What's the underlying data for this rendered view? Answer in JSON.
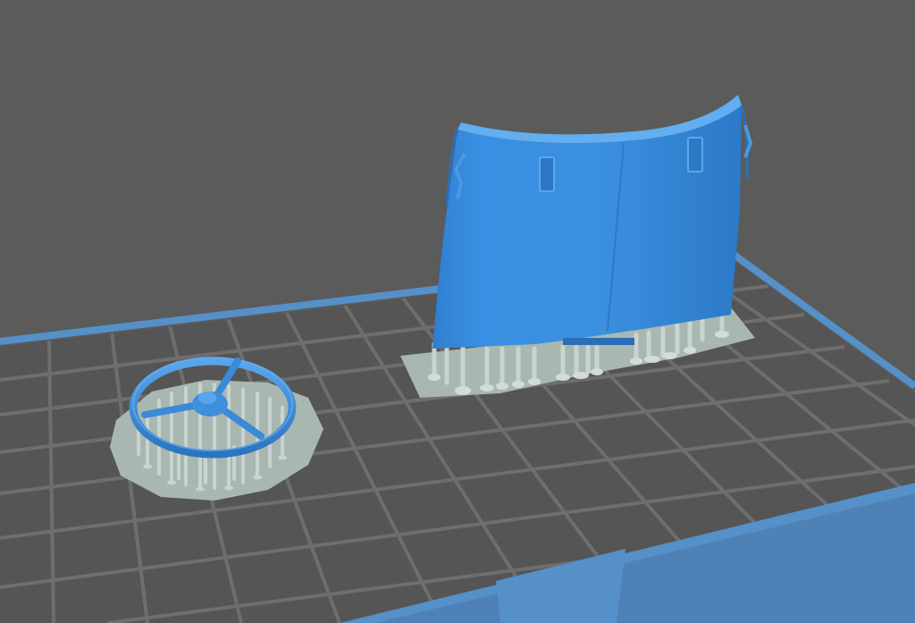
{
  "viewport": {
    "background": "#5b5b5b",
    "plate_color": "#555555",
    "grid_color": "#6e6e6e",
    "border_color": "#5590c8"
  },
  "models": [
    {
      "name": "steering-wheel",
      "color": "#3e8fdc"
    },
    {
      "name": "cabin-wall",
      "color": "#3e8fdc"
    }
  ],
  "supports": {
    "color": "#c9d4d0",
    "raft_color": "#a9b7b1"
  }
}
